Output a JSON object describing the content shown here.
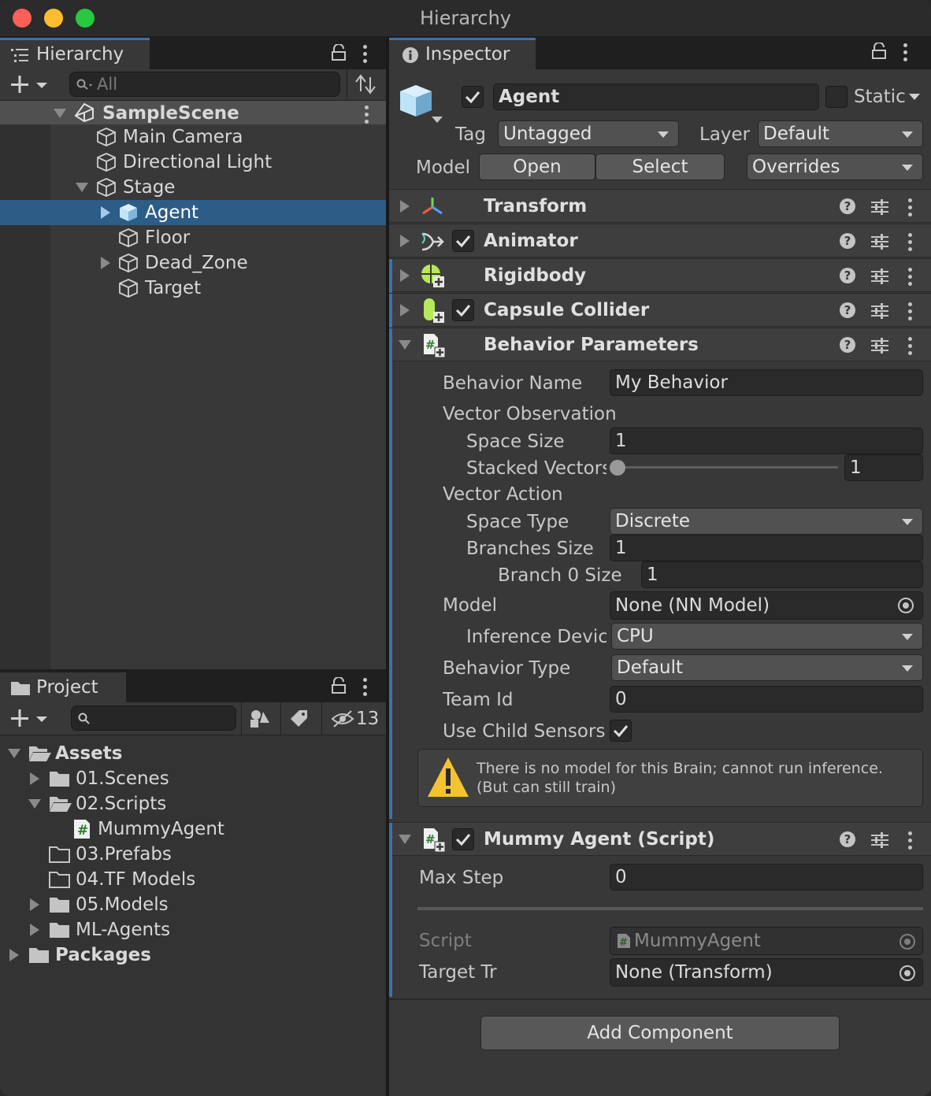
{
  "window": {
    "title": "Hierarchy"
  },
  "hierarchy": {
    "tab_label": "Hierarchy",
    "search_placeholder": "All",
    "scene": "SampleScene",
    "items": [
      {
        "label": "Main Camera"
      },
      {
        "label": "Directional Light"
      },
      {
        "label": "Stage"
      },
      {
        "label": "Agent",
        "selected": true
      },
      {
        "label": "Floor"
      },
      {
        "label": "Dead_Zone"
      },
      {
        "label": "Target"
      }
    ]
  },
  "project": {
    "tab_label": "Project",
    "hidden_count": "13",
    "items": [
      {
        "label": "Assets"
      },
      {
        "label": "01.Scenes"
      },
      {
        "label": "02.Scripts"
      },
      {
        "label": "MummyAgent"
      },
      {
        "label": "03.Prefabs"
      },
      {
        "label": "04.TF Models"
      },
      {
        "label": "05.Models"
      },
      {
        "label": "ML-Agents"
      },
      {
        "label": "Packages"
      }
    ]
  },
  "inspector": {
    "tab_label": "Inspector",
    "object_name": "Agent",
    "static_label": "Static",
    "tag_label": "Tag",
    "tag_value": "Untagged",
    "layer_label": "Layer",
    "layer_value": "Default",
    "model_label": "Model",
    "open_label": "Open",
    "select_label": "Select",
    "overrides_label": "Overrides",
    "components": [
      {
        "name": "Transform"
      },
      {
        "name": "Animator"
      },
      {
        "name": "Rigidbody"
      },
      {
        "name": "Capsule Collider"
      },
      {
        "name": "Behavior Parameters"
      },
      {
        "name": "Mummy Agent (Script)"
      }
    ],
    "behavior": {
      "behavior_name_label": "Behavior Name",
      "behavior_name_value": "My Behavior",
      "vector_observation_label": "Vector Observation",
      "space_size_label": "Space Size",
      "space_size_value": "1",
      "stacked_vectors_label": "Stacked Vectors",
      "stacked_vectors_value": "1",
      "vector_action_label": "Vector Action",
      "space_type_label": "Space Type",
      "space_type_value": "Discrete",
      "branches_size_label": "Branches Size",
      "branches_size_value": "1",
      "branch0_label": "Branch 0 Size",
      "branch0_value": "1",
      "model_label": "Model",
      "model_value": "None (NN Model)",
      "inference_label": "Inference Device",
      "inference_value": "CPU",
      "behavior_type_label": "Behavior Type",
      "behavior_type_value": "Default",
      "team_id_label": "Team Id",
      "team_id_value": "0",
      "use_child_label": "Use Child Sensors",
      "warning_line1": "There is no model for this Brain; cannot run inference.",
      "warning_line2": "(But can still train)"
    },
    "mummy": {
      "max_step_label": "Max Step",
      "max_step_value": "0",
      "script_label": "Script",
      "script_value": "MummyAgent",
      "target_label": "Target Tr",
      "target_value": "None (Transform)"
    },
    "add_component_label": "Add Component"
  },
  "colors": {
    "selection": "#2c5d87",
    "accent_bar": "#3a72b0",
    "warning": "#f4c430"
  }
}
